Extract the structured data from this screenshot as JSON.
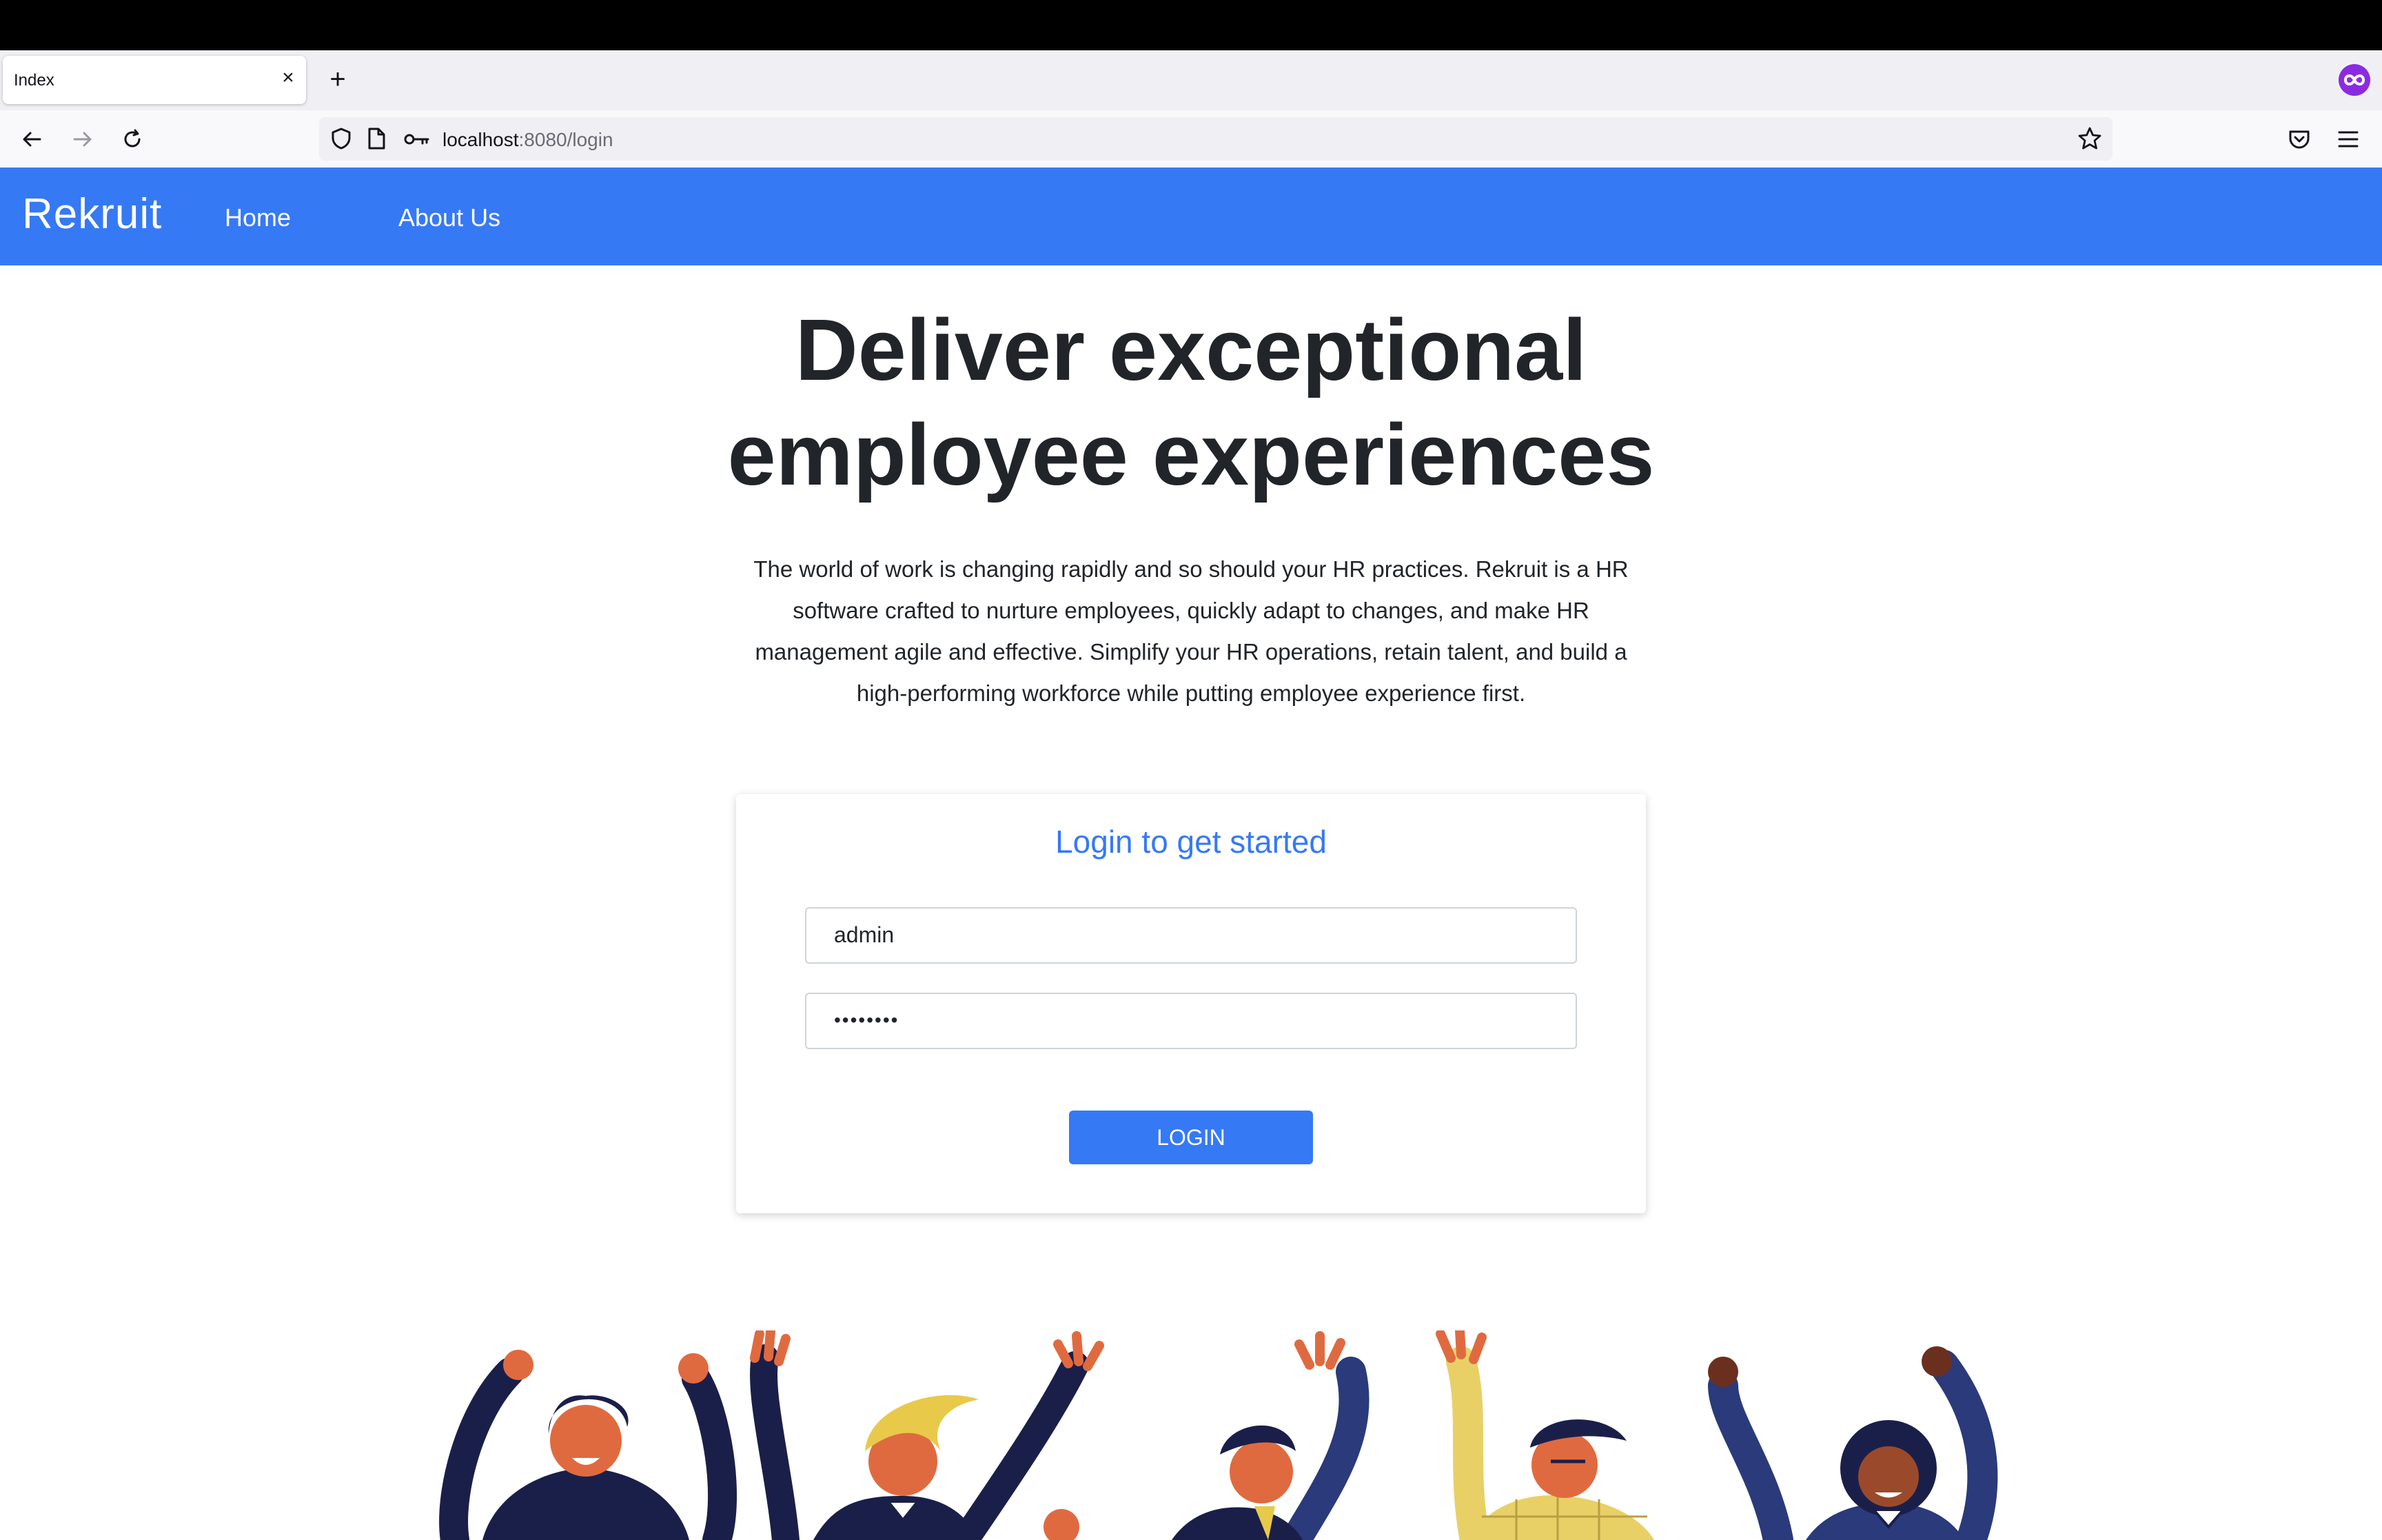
{
  "browser": {
    "tab": {
      "title": "Index",
      "close_icon": "close-icon"
    },
    "new_tab_symbol": "+",
    "url": {
      "host": "localhost",
      "rest": ":8080/login"
    }
  },
  "site": {
    "brand": "Rekruit",
    "nav": [
      {
        "label": "Home"
      },
      {
        "label": "About Us"
      }
    ],
    "accent_color": "#3679f5"
  },
  "hero": {
    "title_line1": "Deliver exceptional",
    "title_line2": "employee experiences",
    "description": "The world of work is changing rapidly and so should your HR practices. Rekruit is a HR software crafted to nurture employees, quickly adapt to changes, and make HR management agile and effective. Simplify your HR operations, retain talent, and build a high-performing workforce while putting employee experience first."
  },
  "login": {
    "title": "Login to get started",
    "username": "admin",
    "password_mask": "••••••••",
    "button": "LOGIN"
  }
}
